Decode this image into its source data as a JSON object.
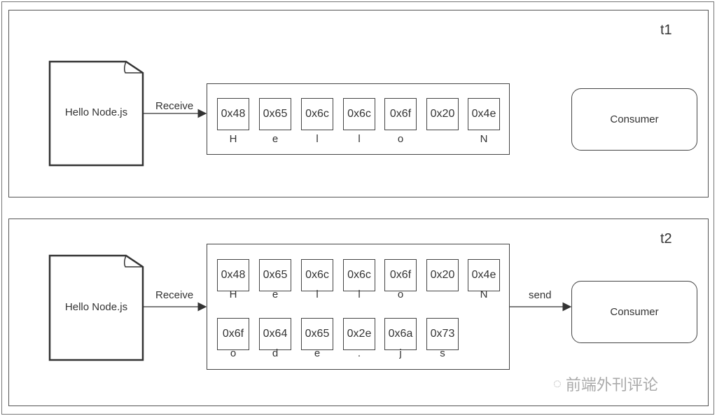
{
  "panels": [
    {
      "label": "t1",
      "source": "Hello Node.js",
      "arrow_in": "Receive",
      "arrow_out": "",
      "consumer": "Consumer",
      "bytes": [
        [
          "0x48",
          "H"
        ],
        [
          "0x65",
          "e"
        ],
        [
          "0x6c",
          "l"
        ],
        [
          "0x6c",
          "l"
        ],
        [
          "0x6f",
          "o"
        ],
        [
          "0x20",
          ""
        ],
        [
          "0x4e",
          "N"
        ]
      ]
    },
    {
      "label": "t2",
      "source": "Hello Node.js",
      "arrow_in": "Receive",
      "arrow_out": "send",
      "consumer": "Consumer",
      "bytes": [
        [
          "0x48",
          "H"
        ],
        [
          "0x65",
          "e"
        ],
        [
          "0x6c",
          "l"
        ],
        [
          "0x6c",
          "l"
        ],
        [
          "0x6f",
          "o"
        ],
        [
          "0x20",
          ""
        ],
        [
          "0x4e",
          "N"
        ],
        [
          "0x6f",
          "o"
        ],
        [
          "0x64",
          "d"
        ],
        [
          "0x65",
          "e"
        ],
        [
          "0x2e",
          "."
        ],
        [
          "0x6a",
          "j"
        ],
        [
          "0x73",
          "s"
        ]
      ]
    }
  ],
  "watermark": "前端外刊评论"
}
